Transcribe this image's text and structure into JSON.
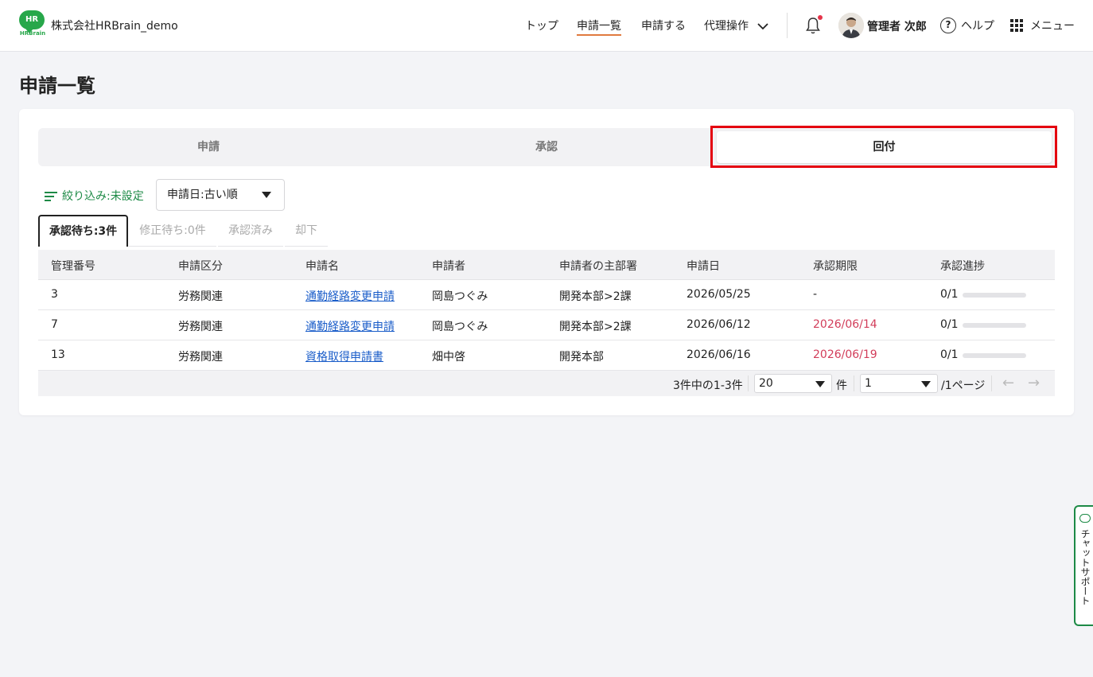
{
  "header": {
    "logo_text": "HR",
    "logo_sub": "HRBrain",
    "company": "株式会社HRBrain_demo",
    "nav": {
      "top": "トップ",
      "list": "申請一覧",
      "apply": "申請する",
      "proxy": "代理操作"
    },
    "user_name": "管理者 次郎",
    "help": "ヘルプ",
    "help_icon_glyph": "?",
    "menu": "メニュー"
  },
  "page": {
    "title": "申請一覧"
  },
  "segments": {
    "apply": "申請",
    "approve": "承認",
    "circulate": "回付",
    "active": "回付"
  },
  "filter": {
    "label": "絞り込み:未設定",
    "sort_value": "申請日:古い順"
  },
  "status_tabs": [
    {
      "label": "承認待ち:3件",
      "active": true
    },
    {
      "label": "修正待ち:0件",
      "active": false
    },
    {
      "label": "承認済み",
      "active": false
    },
    {
      "label": "却下",
      "active": false
    }
  ],
  "table": {
    "columns": [
      "管理番号",
      "申請区分",
      "申請名",
      "申請者",
      "申請者の主部署",
      "申請日",
      "承認期限",
      "承認進捗"
    ],
    "rows": [
      {
        "id": "3",
        "category": "労務関連",
        "name": "通勤経路変更申請",
        "applicant": "岡島つぐみ",
        "dept": "開発本部>2課",
        "date": "2026/05/25",
        "deadline": "-",
        "progress": "0/1",
        "progress_fraction": 0
      },
      {
        "id": "7",
        "category": "労務関連",
        "name": "通勤経路変更申請",
        "applicant": "岡島つぐみ",
        "dept": "開発本部>2課",
        "date": "2026/06/12",
        "deadline": "2026/06/14",
        "progress": "0/1",
        "progress_fraction": 0
      },
      {
        "id": "13",
        "category": "労務関連",
        "name": "資格取得申請書",
        "applicant": "畑中啓",
        "dept": "開発本部",
        "date": "2026/06/16",
        "deadline": "2026/06/19",
        "progress": "0/1",
        "progress_fraction": 0
      }
    ]
  },
  "pager": {
    "summary": "3件中の1-3件",
    "per_page": "20",
    "per_page_unit": "件",
    "page": "1",
    "page_total": "/1ページ",
    "prev": "←",
    "next": "→"
  },
  "chat": {
    "label": "チャットサポート"
  },
  "colors": {
    "brand_green": "#27a74a",
    "highlight_red": "#e4000f",
    "link_blue": "#1a5dc9",
    "deadline_red": "#d23d5a"
  }
}
